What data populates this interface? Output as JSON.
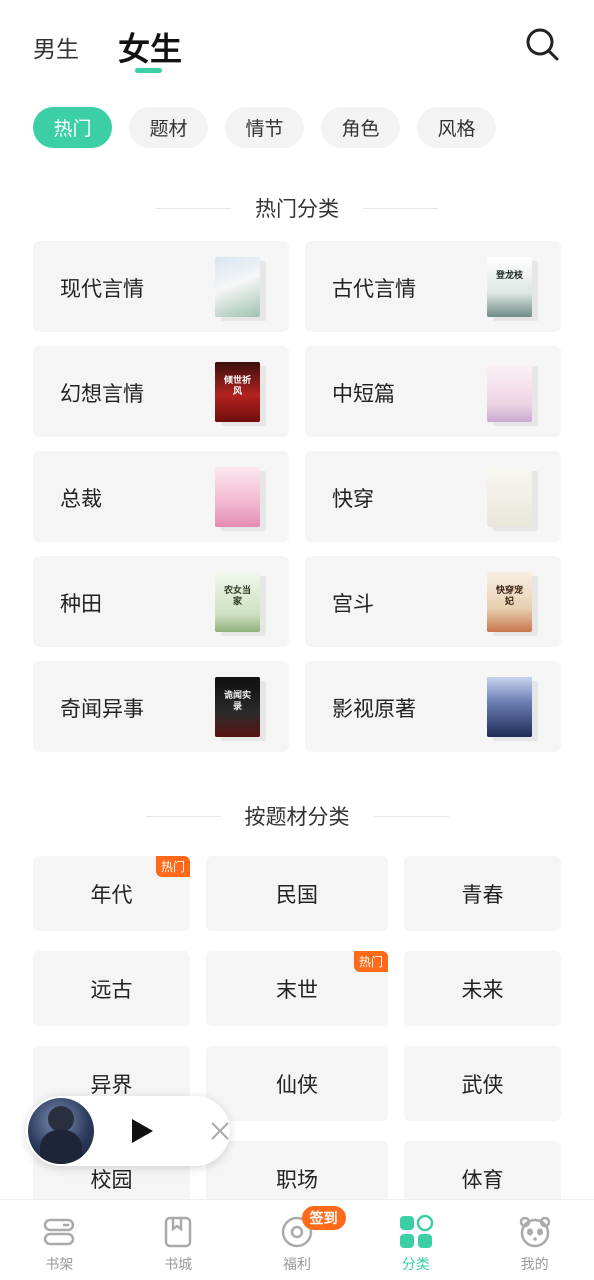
{
  "header": {
    "tab_male": "男生",
    "tab_female": "女生"
  },
  "chips": [
    {
      "label": "热门",
      "active": true
    },
    {
      "label": "题材",
      "active": false
    },
    {
      "label": "情节",
      "active": false
    },
    {
      "label": "角色",
      "active": false
    },
    {
      "label": "风格",
      "active": false
    }
  ],
  "hot_section": {
    "title": "热门分类",
    "items": [
      {
        "label": "现代言情",
        "cover_text": "",
        "cover_color": "#e9eef7"
      },
      {
        "label": "古代言情",
        "cover_text": "登龙枝",
        "cover_color": "#eef0ee"
      },
      {
        "label": "幻想言情",
        "cover_text": "倾世祈风",
        "cover_color": "#b3231f"
      },
      {
        "label": "中短篇",
        "cover_text": "",
        "cover_color": "#f4f1f5"
      },
      {
        "label": "总裁",
        "cover_text": "",
        "cover_color": "#f7d6e2"
      },
      {
        "label": "快穿",
        "cover_text": "",
        "cover_color": "#f2f1ec"
      },
      {
        "label": "种田",
        "cover_text": "农女当家",
        "cover_color": "#e8f1e1"
      },
      {
        "label": "宫斗",
        "cover_text": "快穿宠妃",
        "cover_color": "#f1e6d6"
      },
      {
        "label": "奇闻异事",
        "cover_text": "诡闻实录",
        "cover_color": "#1b1b1b"
      },
      {
        "label": "影视原著",
        "cover_text": "",
        "cover_color": "#2f3f72"
      }
    ]
  },
  "subject_section": {
    "title": "按题材分类",
    "items": [
      {
        "label": "年代",
        "badge": "热门"
      },
      {
        "label": "民国",
        "badge": ""
      },
      {
        "label": "青春",
        "badge": ""
      },
      {
        "label": "远古",
        "badge": ""
      },
      {
        "label": "末世",
        "badge": "热门"
      },
      {
        "label": "未来",
        "badge": ""
      },
      {
        "label": "异界",
        "badge": ""
      },
      {
        "label": "仙侠",
        "badge": ""
      },
      {
        "label": "武侠",
        "badge": ""
      },
      {
        "label": "校园",
        "badge": ""
      },
      {
        "label": "职场",
        "badge": ""
      },
      {
        "label": "体育",
        "badge": ""
      }
    ]
  },
  "player": {
    "play_icon": "play-icon",
    "close_icon": "close-icon"
  },
  "bottom_nav": [
    {
      "label": "书架",
      "icon": "bookshelf-icon",
      "active": false
    },
    {
      "label": "书城",
      "icon": "bookstore-icon",
      "active": false
    },
    {
      "label": "福利",
      "icon": "welfare-icon",
      "active": false,
      "badge": "签到"
    },
    {
      "label": "分类",
      "icon": "category-icon",
      "active": true
    },
    {
      "label": "我的",
      "icon": "profile-icon",
      "active": false
    }
  ],
  "colors": {
    "accent": "#3ccfa5",
    "badge": "#ff6a1a",
    "card_bg": "#f5f5f5"
  }
}
